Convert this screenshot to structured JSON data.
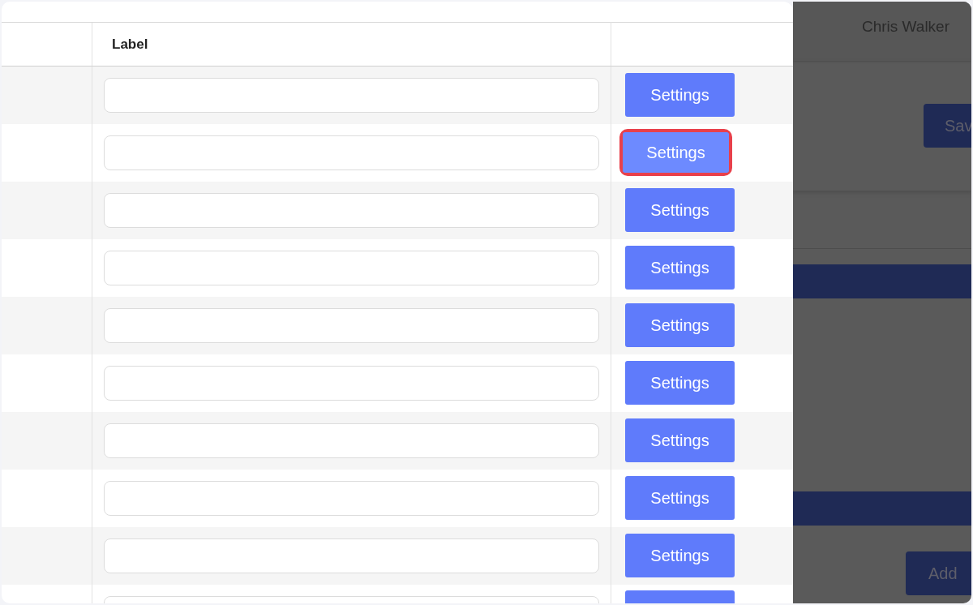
{
  "table": {
    "label_header": "Label",
    "rows": [
      {
        "label_value": "",
        "button": "Settings",
        "highlighted": false
      },
      {
        "label_value": "",
        "button": "Settings",
        "highlighted": true
      },
      {
        "label_value": "",
        "button": "Settings",
        "highlighted": false
      },
      {
        "label_value": "",
        "button": "Settings",
        "highlighted": false
      },
      {
        "label_value": "",
        "button": "Settings",
        "highlighted": false
      },
      {
        "label_value": "",
        "button": "Settings",
        "highlighted": false
      },
      {
        "label_value": "",
        "button": "Settings",
        "highlighted": false
      },
      {
        "label_value": "",
        "button": "Settings",
        "highlighted": false
      },
      {
        "label_value": "",
        "button": "Settings",
        "highlighted": false
      },
      {
        "label_value": "",
        "highlighted": false
      }
    ]
  },
  "background_page": {
    "user_name": "Chris Walker",
    "save_button": "Sav",
    "add_button": "Add"
  }
}
